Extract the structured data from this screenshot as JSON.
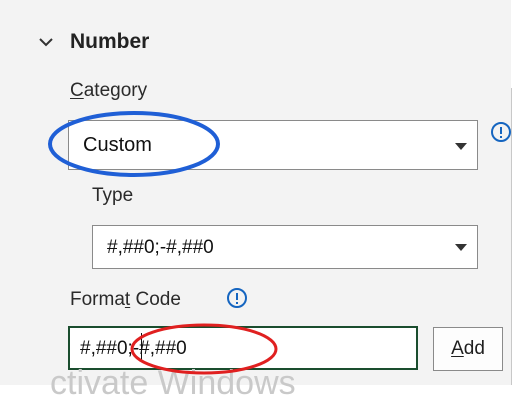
{
  "section": {
    "title": "Number"
  },
  "category": {
    "label_first": "C",
    "label_rest": "ategory",
    "selected": "Custom"
  },
  "type": {
    "label": "Type",
    "selected": "#,##0;-#,##0"
  },
  "format_code": {
    "label_before": "Forma",
    "label_underlined": "t",
    "label_after": " Code",
    "value": "#,##0;-#,##0"
  },
  "add_button": {
    "label_underlined": "A",
    "label_rest": "dd"
  },
  "watermark": {
    "text": "ctivate Windows"
  },
  "icons": {
    "collapse": "chevron-down-icon",
    "info": "info-icon"
  },
  "colors": {
    "blue_annotation": "#1f5fd6",
    "red_annotation": "#e02020",
    "info_icon": "#1565c0",
    "input_border": "#1a4d2e"
  }
}
